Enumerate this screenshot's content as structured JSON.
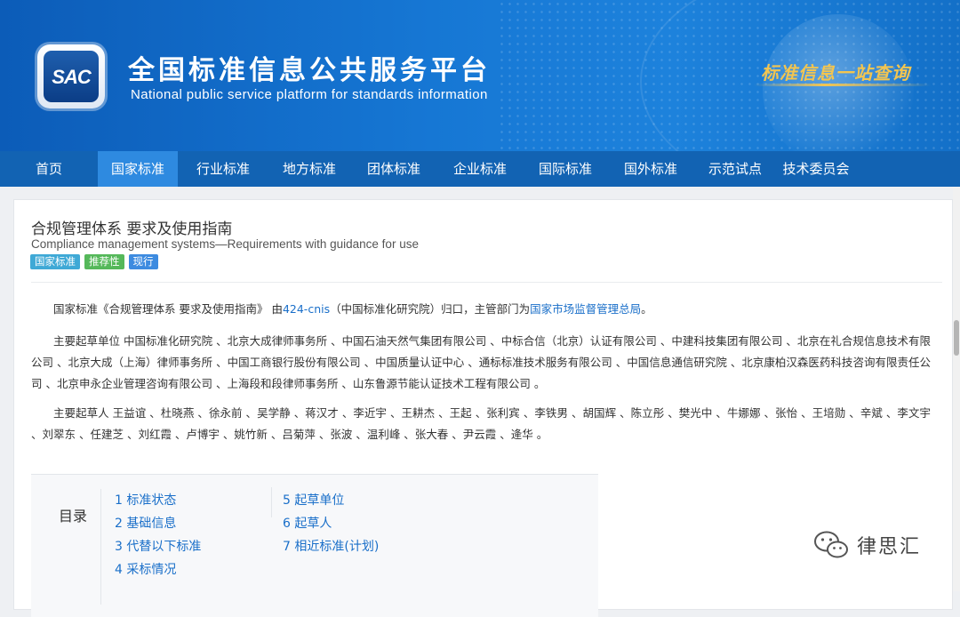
{
  "header": {
    "logo_text": "SAC",
    "title": "全国标准信息公共服务平台",
    "subtitle": "National public service platform  for standards information",
    "slogan": "标准信息一站查询"
  },
  "nav": {
    "items": [
      {
        "label": "首页"
      },
      {
        "label": "国家标准",
        "active": true
      },
      {
        "label": "行业标准"
      },
      {
        "label": "地方标准"
      },
      {
        "label": "团体标准"
      },
      {
        "label": "企业标准"
      },
      {
        "label": "国际标准"
      },
      {
        "label": "国外标准"
      },
      {
        "label": "示范试点"
      },
      {
        "label": "技术委员会"
      }
    ]
  },
  "standard": {
    "title": "合规管理体系 要求及使用指南",
    "title_en": "Compliance management systems—Requirements with guidance for use",
    "tags": [
      {
        "label": "国家标准",
        "color": "#3fa9d6"
      },
      {
        "label": "推荐性",
        "color": "#55b85a"
      },
      {
        "label": "现行",
        "color": "#3d8be0"
      }
    ],
    "intro": {
      "prefix": "国家标准《合规管理体系 要求及使用指南》 由",
      "tc_code": "424-cnis",
      "middle": "（中国标准化研究院）归口，主管部门为",
      "authority": "国家市场监督管理总局",
      "suffix": "。"
    },
    "drafting_units": "主要起草单位 中国标准化研究院 、北京大成律师事务所 、中国石油天然气集团有限公司 、中标合信（北京）认证有限公司 、中建科技集团有限公司 、北京在礼合规信息技术有限公司 、北京大成（上海）律师事务所 、中国工商银行股份有限公司 、中国质量认证中心 、通标标准技术服务有限公司 、中国信息通信研究院 、北京康柏汉森医药科技咨询有限责任公司 、北京申永企业管理咨询有限公司 、上海段和段律师事务所 、山东鲁源节能认证技术工程有限公司 。",
    "drafters": "主要起草人 王益谊 、杜晓燕 、徐永前 、吴学静 、蒋汉才 、李近宇 、王耕杰 、王起 、张利宾 、李铁男 、胡国辉 、陈立彤 、樊光中 、牛娜娜 、张怡 、王培勋 、辛斌 、李文宇 、刘翠东 、任建芝 、刘红霞 、卢博宇 、姚竹新 、吕菊萍 、张波 、温利峰 、张大春 、尹云霞 、逄华 。"
  },
  "toc": {
    "label": "目录",
    "items": [
      {
        "label": "1 标准状态"
      },
      {
        "label": "2 基础信息"
      },
      {
        "label": "3 代替以下标准"
      },
      {
        "label": "4 采标情况"
      },
      {
        "label": "5 起草单位"
      },
      {
        "label": "6 起草人"
      },
      {
        "label": "7 相近标准(计划)"
      }
    ]
  },
  "watermark": {
    "text": "律思汇",
    "icon": "wechat-icon"
  }
}
